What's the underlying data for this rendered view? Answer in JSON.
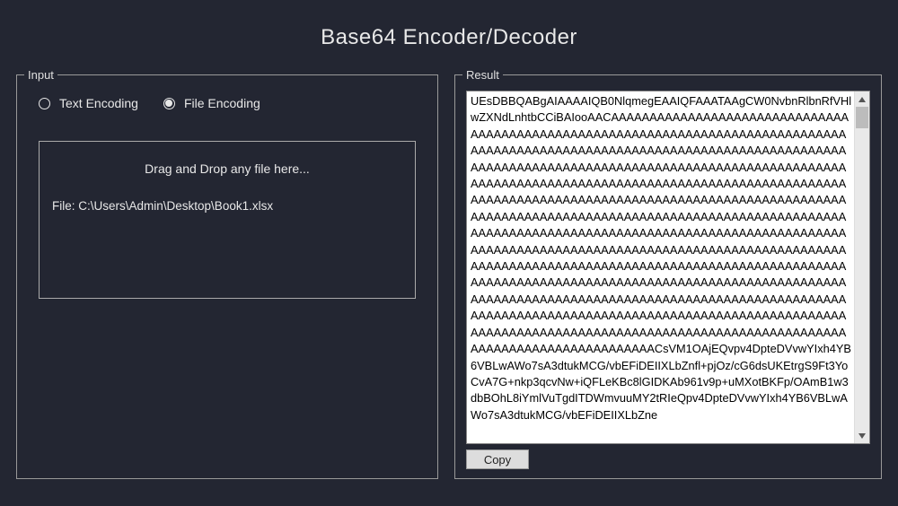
{
  "title": "Base64 Encoder/Decoder",
  "input": {
    "legend": "Input",
    "radios": {
      "text_label": "Text Encoding",
      "file_label": "File Encoding",
      "selected": "file"
    },
    "dropzone": {
      "instruction": "Drag and Drop any file here...",
      "file_prefix": "File: ",
      "file_path": "C:\\Users\\Admin\\Desktop\\Book1.xlsx"
    }
  },
  "result": {
    "legend": "Result",
    "copy_label": "Copy",
    "text": "UEsDBBQABgAIAAAAIQB0NlqmegEAAIQFAAATAAgCW0NvbnRlbnRfVHlwZXNdLnhtbCCiBAIooAACAAAAAAAAAAAAAAAAAAAAAAAAAAAAAAAAAAAAAAAAAAAAAAAAAAAAAAAAAAAAAAAAAAAAAAAAAAAAAAAAAAAAAAAAAAAAAAAAAAAAAAAAAAAAAAAAAAAAAAAAAAAAAAAAAAAAAAAAAAAAAAAAAAAAAAAAAAAAAAAAAAAAAAAAAAAAAAAAAAAAAAAAAAAAAAAAAAAAAAAAAAAAAAAAAAAAAAAAAAAAAAAAAAAAAAAAAAAAAAAAAAAAAAAAAAAAAAAAAAAAAAAAAAAAAAAAAAAAAAAAAAAAAAAAAAAAAAAAAAAAAAAAAAAAAAAAAAAAAAAAAAAAAAAAAAAAAAAAAAAAAAAAAAAAAAAAAAAAAAAAAAAAAAAAAAAAAAAAAAAAAAAAAAAAAAAAAAAAAAAAAAAAAAAAAAAAAAAAAAAAAAAAAAAAAAAAAAAAAAAAAAAAAAAAAAAAAAAAAAAAAAAAAAAAAAAAAAAAAAAAAAAAAAAAAAAAAAAAAAAAAAAAAAAAAAAAAAAAAAAAAAAAAAAAAAAAAAAAAAAAAAAAAAAAAAAAAAAAAAAAAAAAAAAAAAAAAAAAAAAAAAAAAAAAAAAAAAAAAAAAAAAAAAAAAAAAAAAAAAAAAAAAAAAAAAAAAAAAAAAAAAAAAAAAAAAAAAAAAAAAAAAAAAAAAAAAAAAAAAAAAAAAAAAAAAAACsVM1OAjEQvpv4DpteDVvwYIxh4YB6VBLwAWo7sA3dtukMCG/vbEFiDEIIXLbZnfl+pjOz/cG6dsUKEtrgS9Ft3YoCvA7G+nkp3qcvNw+iQFLeKBc8lGIDKAb961v9p+uMXotBKFp/OAmB1w3dbBOhL8iYmlVuTgdITDWmvuuMY2tRIeQpv4DpteDVvwYIxh4YB6VBLwAWo7sA3dtukMCG/vbEFiDEIIXLbZne"
  }
}
